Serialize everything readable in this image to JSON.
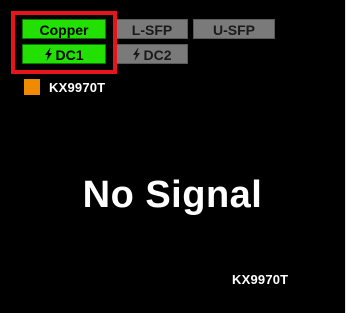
{
  "buttons": {
    "copper": {
      "label": "Copper",
      "active": true
    },
    "lsfp": {
      "label": "L-SFP",
      "active": false
    },
    "usfp": {
      "label": "U-SFP",
      "active": false
    },
    "dc1": {
      "label": "DC1",
      "active": true
    },
    "dc2": {
      "label": "DC2",
      "active": false
    }
  },
  "device": {
    "name": "KX9970T",
    "color": "#f08a00"
  },
  "screen": {
    "message": "No Signal",
    "osd_name": "KX9970T"
  },
  "colors": {
    "active": "#22e000",
    "inactive": "#7a7a7a",
    "selection": "#e8141b",
    "background": "#000000"
  },
  "icons": {
    "power": "lightning-bolt"
  }
}
